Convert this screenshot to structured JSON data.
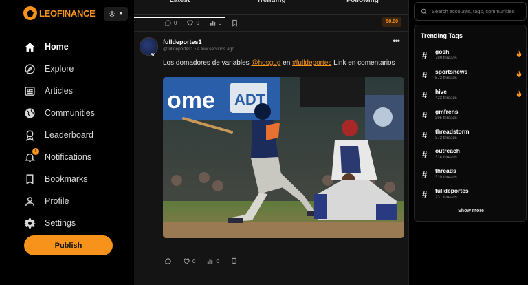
{
  "brand": {
    "name": "LEOFINANCE",
    "accent": "#f7931a"
  },
  "settings_toggle": {
    "icon": "gear-icon"
  },
  "nav": [
    {
      "label": "Home",
      "icon": "home-icon",
      "active": true
    },
    {
      "label": "Explore",
      "icon": "compass-icon"
    },
    {
      "label": "Articles",
      "icon": "articles-icon"
    },
    {
      "label": "Communities",
      "icon": "globe-icon"
    },
    {
      "label": "Leaderboard",
      "icon": "award-icon"
    },
    {
      "label": "Notifications",
      "icon": "bell-icon",
      "badge": "!"
    },
    {
      "label": "Bookmarks",
      "icon": "bookmark-icon"
    },
    {
      "label": "Profile",
      "icon": "user-icon"
    },
    {
      "label": "Settings",
      "icon": "gear-icon"
    }
  ],
  "publish_label": "Publish",
  "tabs": [
    {
      "label": "Latest",
      "active": true
    },
    {
      "label": "Trending"
    },
    {
      "label": "Following"
    }
  ],
  "prev_post_actions": {
    "comments": "0",
    "likes": "0",
    "stats": "0",
    "amount": "$0.00"
  },
  "post": {
    "username": "fulldeportes1",
    "handle": "@fulldeportes1",
    "time": "a few seconds ago",
    "reputation": "50",
    "more_icon": "•••",
    "text_before": "Los domadores de variables ",
    "mention": "@hosgug",
    "text_middle": " en ",
    "hashtag": "#fulldeportes",
    "text_after": " Link en comentarios",
    "actions": {
      "likes": "0",
      "stats": "0"
    }
  },
  "search": {
    "placeholder": "Search accounts, tags, communities"
  },
  "trending": {
    "title": "Trending Tags",
    "tags": [
      {
        "name": "gosh",
        "count": "789 threads",
        "hot": true
      },
      {
        "name": "sportsnews",
        "count": "572 threads",
        "hot": true
      },
      {
        "name": "hive",
        "count": "423 threads",
        "hot": true
      },
      {
        "name": "gmfrens",
        "count": "395 threads",
        "hot": false
      },
      {
        "name": "threadstorm",
        "count": "372 threads",
        "hot": false
      },
      {
        "name": "outreach",
        "count": "314 threads",
        "hot": false
      },
      {
        "name": "threads",
        "count": "310 threads",
        "hot": false
      },
      {
        "name": "fulldeportes",
        "count": "231 threads",
        "hot": false
      }
    ],
    "show_more": "Show more"
  }
}
